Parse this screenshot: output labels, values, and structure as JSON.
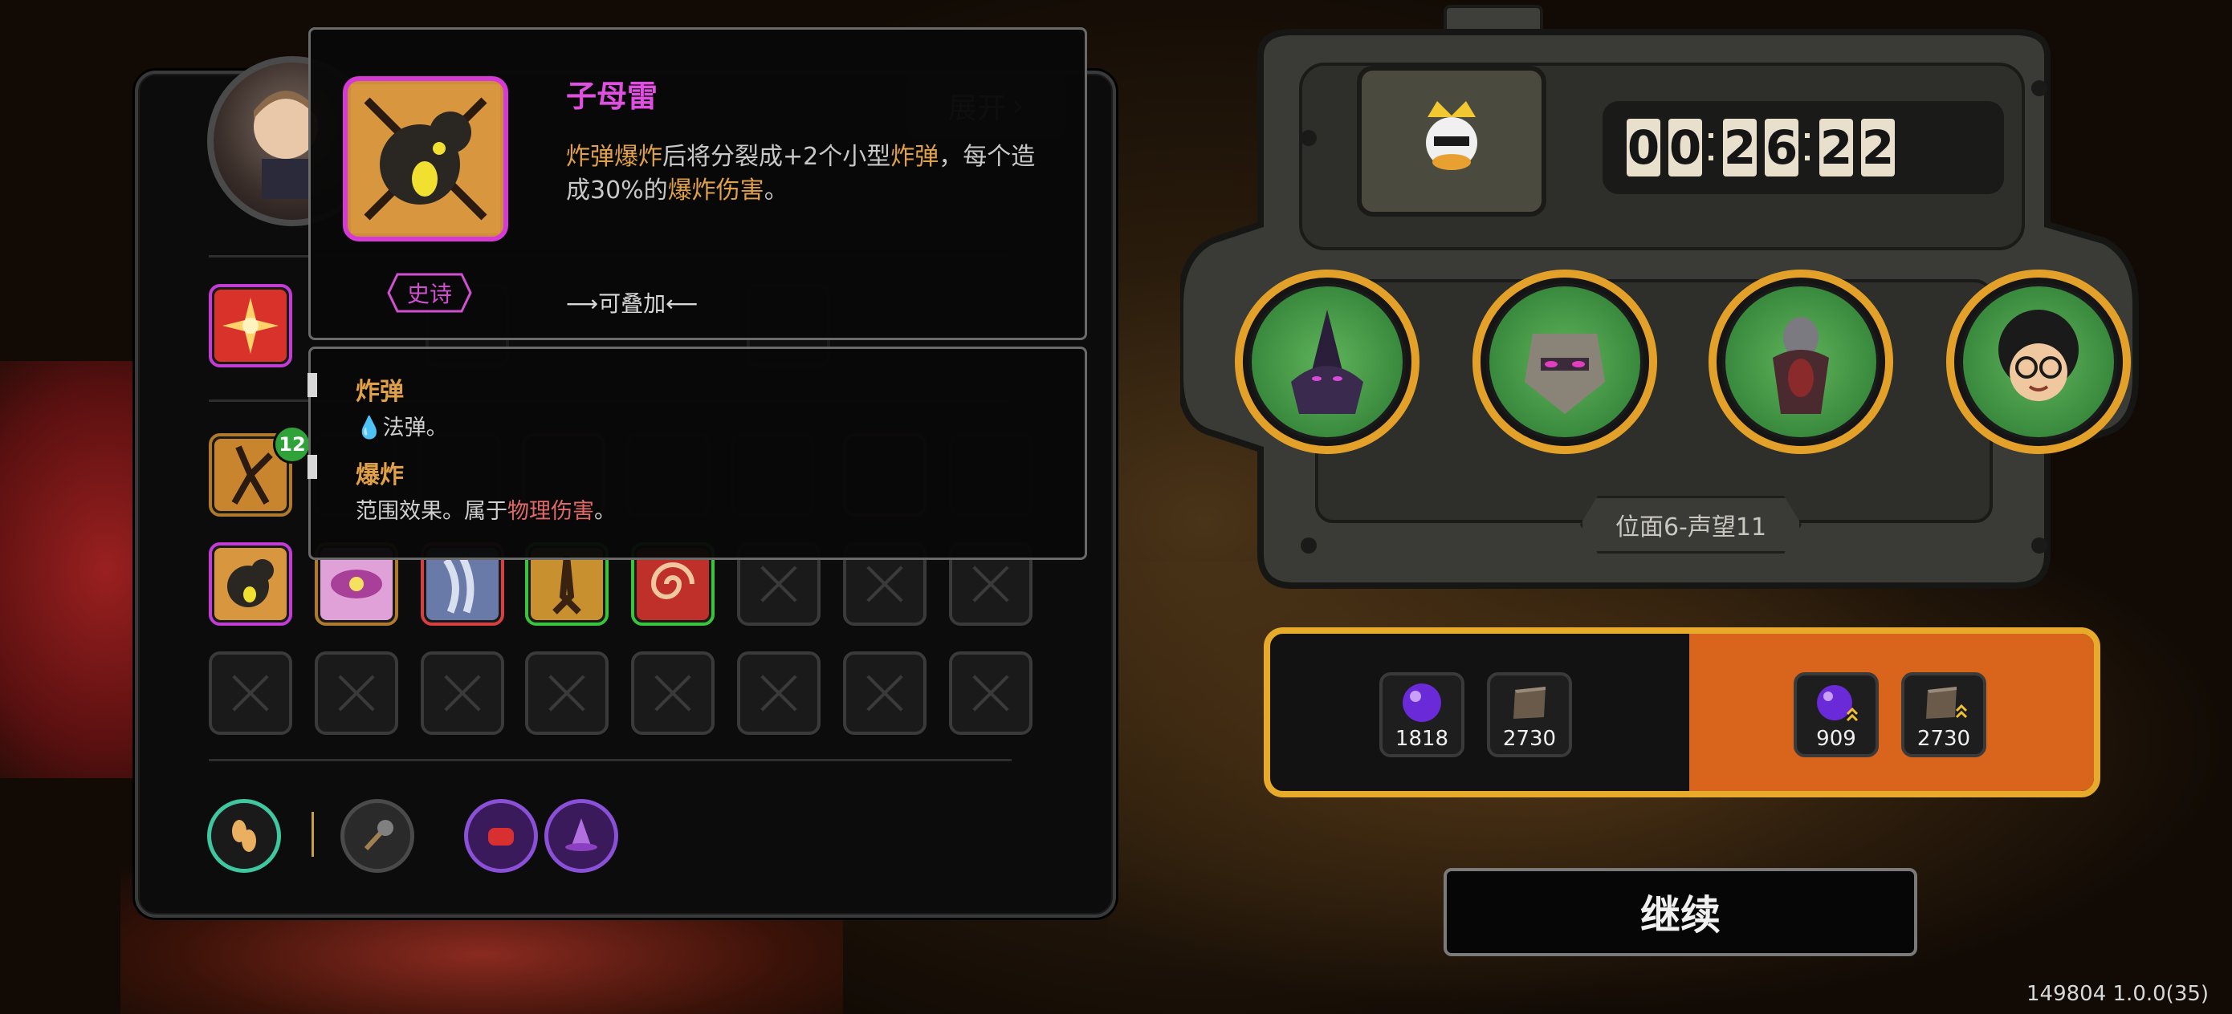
{
  "panel": {
    "expand_label": "展开",
    "badge_level": "12"
  },
  "tooltip": {
    "title": "子母雷",
    "desc_part1": "炸弹爆炸",
    "desc_part2": "后将分裂成+2个小型",
    "desc_part3": "炸弹",
    "desc_part4": "，每个造成30%的",
    "desc_part5": "爆炸伤害",
    "desc_part6": "。",
    "rarity": "史诗",
    "stack_note": "⟶可叠加⟵"
  },
  "keywords": {
    "bomb_title": "炸弹",
    "bomb_desc": "法弹。",
    "explode_title": "爆炸",
    "explode_desc_part1": "范围效果。属于",
    "explode_desc_part2": "物理伤害",
    "explode_desc_part3": "。"
  },
  "timer": {
    "digits": [
      "0",
      "0",
      "2",
      "6",
      "2",
      "2"
    ]
  },
  "stage": {
    "label": "位面6-声望11"
  },
  "rewards": {
    "base": [
      {
        "icon": "purple-orb-icon",
        "value": "1818"
      },
      {
        "icon": "book-icon",
        "value": "2730"
      }
    ],
    "bonus": [
      {
        "icon": "purple-orb-upgrade-icon",
        "value": "909"
      },
      {
        "icon": "book-upgrade-icon",
        "value": "2730"
      }
    ]
  },
  "continue_label": "继续",
  "version": "149804 1.0.0(35)",
  "colors": {
    "accent_gold": "#e8aa2a",
    "epic_purple": "#d63ad6",
    "reward_orange": "#d9641c",
    "hero_green": "#3a8a3e"
  }
}
